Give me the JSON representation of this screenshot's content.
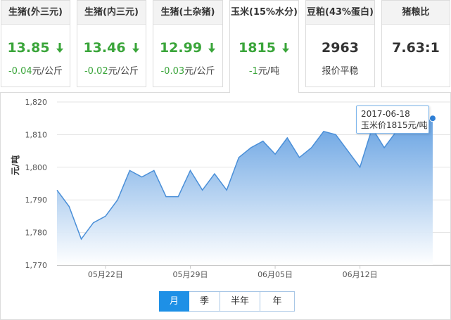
{
  "cards": [
    {
      "title": "生猪(外三元)",
      "value": "13.85",
      "trend": "down",
      "change_num": "-0.04",
      "change_unit": "元/公斤"
    },
    {
      "title": "生猪(内三元)",
      "value": "13.46",
      "trend": "down",
      "change_num": "-0.02",
      "change_unit": "元/公斤"
    },
    {
      "title": "生猪(土杂猪)",
      "value": "12.99",
      "trend": "down",
      "change_num": "-0.03",
      "change_unit": "元/公斤"
    },
    {
      "title": "玉米(15%水分)",
      "value": "1815",
      "trend": "down",
      "change_num": "-1",
      "change_unit": "元/吨"
    },
    {
      "title": "豆粕(43%蛋白)",
      "value": "2963",
      "trend": "flat",
      "change_num": "",
      "change_unit": "报价平稳"
    },
    {
      "title": "猪粮比",
      "value": "7.63:1",
      "trend": "none",
      "change_num": "",
      "change_unit": ""
    }
  ],
  "tooltip": {
    "date": "2017-06-18",
    "text": "玉米价1815元/吨"
  },
  "periods": [
    {
      "label": "月",
      "active": true
    },
    {
      "label": "季",
      "active": false
    },
    {
      "label": "半年",
      "active": false
    },
    {
      "label": "年",
      "active": false
    }
  ],
  "colors": {
    "line": "#4a8fd8",
    "area_top": "#5b9be0",
    "area_bottom": "#ffffff",
    "green": "#3aa53a",
    "tab_active": "#1e90e6"
  },
  "chart_data": {
    "type": "area",
    "ylabel": "元/吨",
    "xlabel": "",
    "ylim": [
      1770,
      1820
    ],
    "yticks": [
      1770,
      1780,
      1790,
      1800,
      1810,
      1820
    ],
    "ytick_labels": [
      "1,770",
      "1,780",
      "1,790",
      "1,800",
      "1,810",
      "1,820"
    ],
    "xtick_labels": [
      {
        "date": "2017-05-22",
        "label": "05月22日"
      },
      {
        "date": "2017-05-29",
        "label": "05月29日"
      },
      {
        "date": "2017-06-05",
        "label": "06月05日"
      },
      {
        "date": "2017-06-12",
        "label": "06月12日"
      }
    ],
    "grid": true,
    "series": [
      {
        "x": [
          "2017-05-18",
          "2017-05-19",
          "2017-05-20",
          "2017-05-21",
          "2017-05-22",
          "2017-05-23",
          "2017-05-24",
          "2017-05-25",
          "2017-05-26",
          "2017-05-27",
          "2017-05-28",
          "2017-05-29",
          "2017-05-30",
          "2017-05-31",
          "2017-06-01",
          "2017-06-02",
          "2017-06-03",
          "2017-06-04",
          "2017-06-05",
          "2017-06-06",
          "2017-06-07",
          "2017-06-08",
          "2017-06-09",
          "2017-06-10",
          "2017-06-11",
          "2017-06-12",
          "2017-06-13",
          "2017-06-14",
          "2017-06-15",
          "2017-06-16",
          "2017-06-17",
          "2017-06-18"
        ],
        "values": [
          1793,
          1788,
          1778,
          1783,
          1785,
          1790,
          1799,
          1797,
          1799,
          1791,
          1791,
          1799,
          1793,
          1798,
          1793,
          1803,
          1806,
          1808,
          1804,
          1809,
          1803,
          1806,
          1811,
          1810,
          1805,
          1800,
          1812,
          1806,
          1811,
          1816,
          1815,
          1815
        ]
      }
    ],
    "highlight": {
      "x": "2017-06-18",
      "y": 1815
    }
  }
}
